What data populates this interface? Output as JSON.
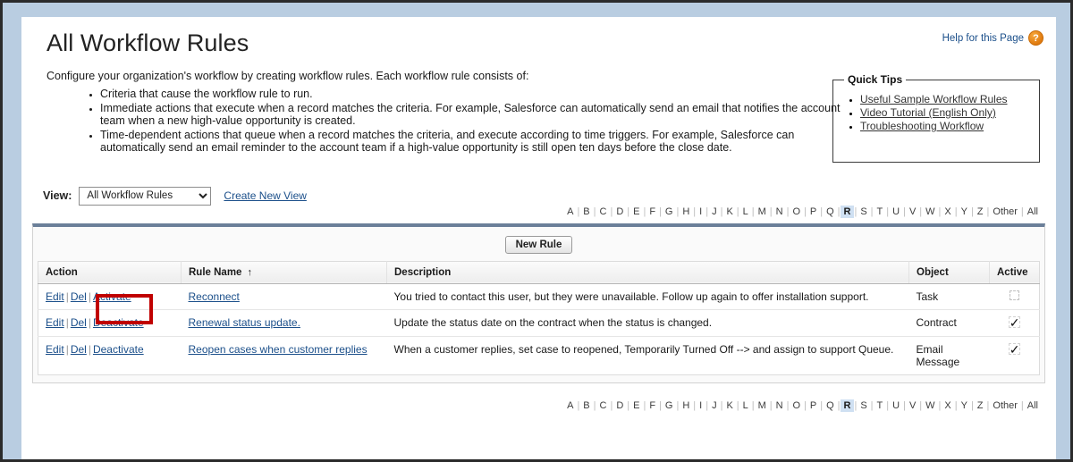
{
  "page": {
    "title": "All Workflow Rules",
    "help_link": "Help for this Page",
    "help_icon": "question-mark-icon",
    "intro": "Configure your organization's workflow by creating workflow rules. Each workflow rule consists of:",
    "bullets": [
      "Criteria that cause the workflow rule to run.",
      "Immediate actions that execute when a record matches the criteria. For example, Salesforce can automatically send an email that notifies the account team when a new high-value opportunity is created.",
      "Time-dependent actions that queue when a record matches the criteria, and execute according to time triggers. For example, Salesforce can automatically send an email reminder to the account team if a high-value opportunity is still open ten days before the close date."
    ]
  },
  "quick_tips": {
    "legend": "Quick Tips",
    "links": [
      "Useful Sample Workflow Rules",
      "Video Tutorial (English Only)",
      "Troubleshooting Workflow"
    ]
  },
  "view_bar": {
    "label": "View:",
    "selected": "All Workflow Rules",
    "options": [
      "All Workflow Rules"
    ],
    "create_new_view": "Create New View",
    "dropdown_icon": "chevron-down-icon"
  },
  "alpha_index": {
    "letters": [
      "A",
      "B",
      "C",
      "D",
      "E",
      "F",
      "G",
      "H",
      "I",
      "J",
      "K",
      "L",
      "M",
      "N",
      "O",
      "P",
      "Q",
      "R",
      "S",
      "T",
      "U",
      "V",
      "W",
      "X",
      "Y",
      "Z",
      "Other",
      "All"
    ],
    "active": "R"
  },
  "list": {
    "new_rule_label": "New Rule",
    "columns": [
      "Action",
      "Rule Name",
      "Description",
      "Object",
      "Active"
    ],
    "sort_column": "Rule Name",
    "sort_arrow": "↑",
    "rows": [
      {
        "actions": [
          "Edit",
          "Del",
          "Activate"
        ],
        "rule_name": "Reconnect",
        "description": "You tried to contact this user, but they were unavailable. Follow up again to offer installation support.",
        "object": "Task",
        "active": false
      },
      {
        "actions": [
          "Edit",
          "Del",
          "Deactivate"
        ],
        "rule_name": "Renewal status update.",
        "description": "Update the status date on the contract when the status is changed.",
        "object": "Contract",
        "active": true
      },
      {
        "actions": [
          "Edit",
          "Del",
          "Deactivate"
        ],
        "rule_name": "Reopen cases when customer replies",
        "description": "When a customer replies, set case to reopened, Temporarily Turned Off --> and assign to support Queue.",
        "object": "Email Message",
        "active": true
      }
    ]
  },
  "annotation": {
    "target": "Activate",
    "color": "#c00000"
  },
  "colors": {
    "link": "#1b4f8a",
    "backdrop": "#b9cde1",
    "panel_top_bar": "#6b7f99",
    "active_letter_bg": "#cfe0f2",
    "help_badge": "#e07b10"
  }
}
